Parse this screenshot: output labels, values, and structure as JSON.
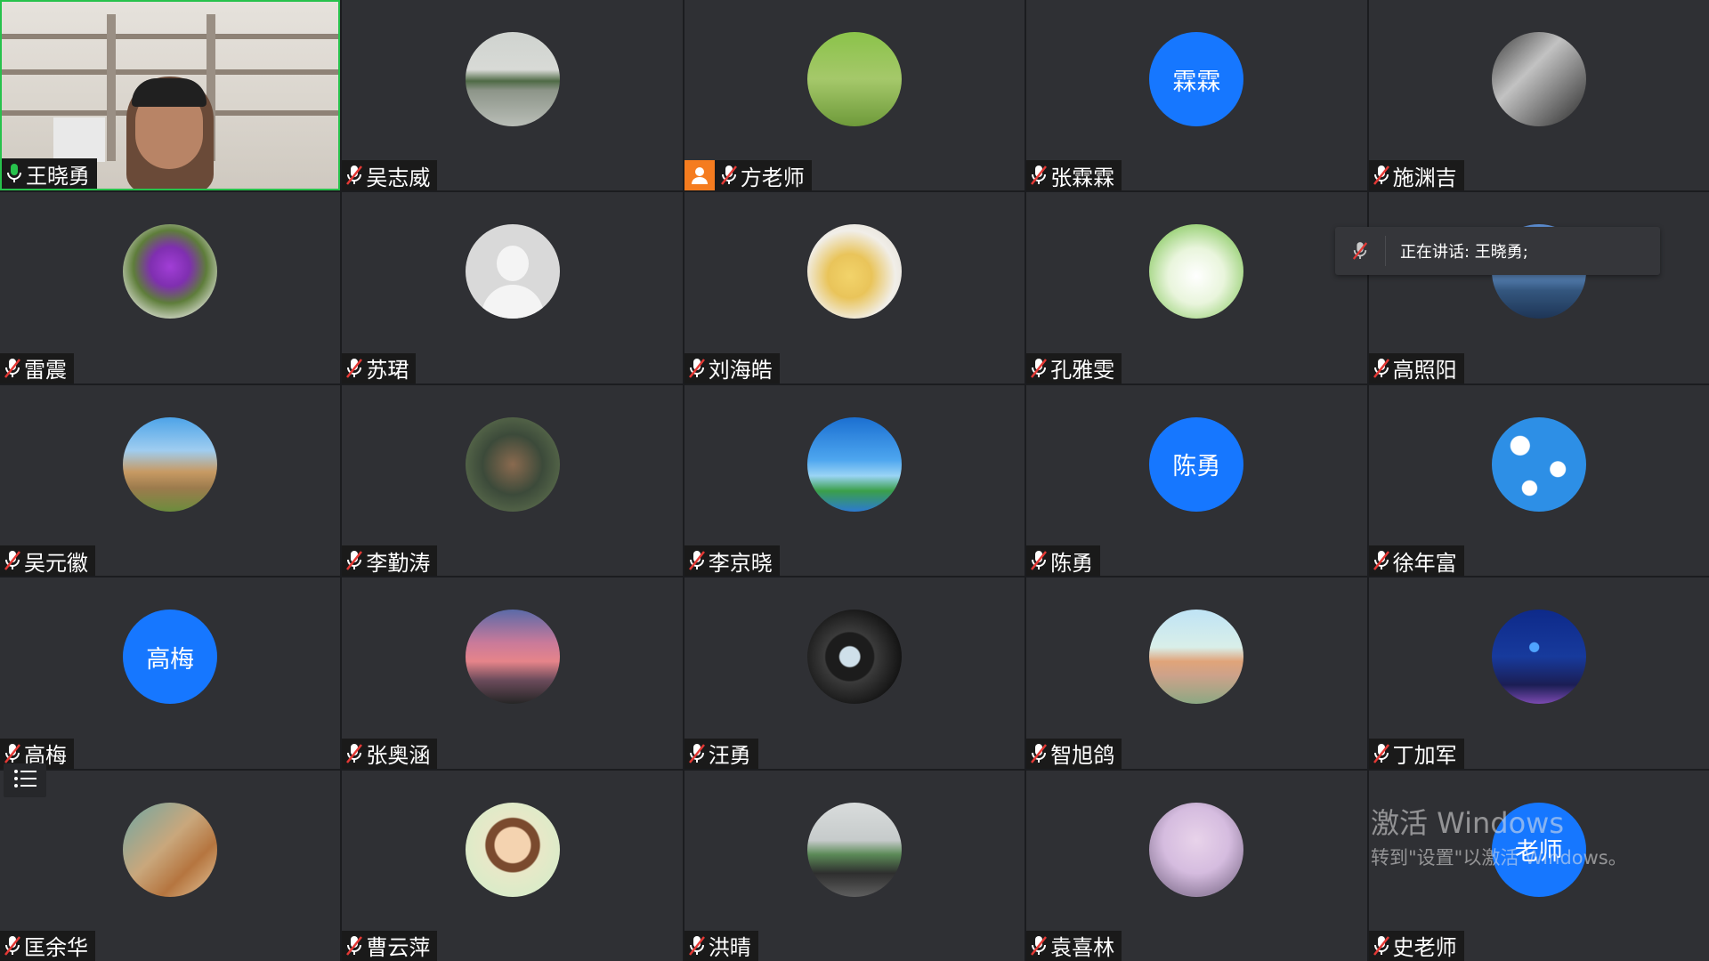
{
  "active_speaker": "王晓勇",
  "speaking_toast": {
    "label": "正在讲话: 王晓勇;"
  },
  "watermark": {
    "title": "激活 Windows",
    "subtitle": "转到\"设置\"以激活 Windows。"
  },
  "colors": {
    "tile_bg": "#2f3034",
    "accent_blue": "#1677ff",
    "active_border": "#27c24c",
    "host_badge": "#f57c1f",
    "mic_muted": "#e53935",
    "mic_on": "#27c24c"
  },
  "participants": [
    {
      "name": "王晓勇",
      "avatar": "camera-video",
      "mic": "on",
      "active": true
    },
    {
      "name": "吴志威",
      "avatar": "photo-lake",
      "mic": "muted"
    },
    {
      "name": "方老师",
      "avatar": "photo-cartoon",
      "mic": "muted",
      "host": true
    },
    {
      "name": "张霖霖",
      "avatar_text": "霖霖",
      "avatar": "initials",
      "mic": "muted"
    },
    {
      "name": "施渊吉",
      "avatar": "photo-portrait",
      "mic": "muted"
    },
    {
      "name": "雷震",
      "avatar": "photo-flower",
      "mic": "muted"
    },
    {
      "name": "苏珺",
      "avatar": "default-person",
      "mic": "muted"
    },
    {
      "name": "刘海皓",
      "avatar": "photo-pet",
      "mic": "muted"
    },
    {
      "name": "孔雅雯",
      "avatar": "photo-cartoon-frog",
      "mic": "muted"
    },
    {
      "name": "高照阳",
      "avatar": "photo-mountain",
      "mic": "muted"
    },
    {
      "name": "吴元徽",
      "avatar": "photo-castle",
      "mic": "muted"
    },
    {
      "name": "李勤涛",
      "avatar": "photo-family",
      "mic": "muted"
    },
    {
      "name": "李京晓",
      "avatar": "photo-sky-island",
      "mic": "muted"
    },
    {
      "name": "陈勇",
      "avatar_text": "陈勇",
      "avatar": "initials",
      "mic": "muted"
    },
    {
      "name": "徐年富",
      "avatar": "photo-clouds",
      "mic": "muted"
    },
    {
      "name": "高梅",
      "avatar_text": "高梅",
      "avatar": "initials",
      "mic": "muted"
    },
    {
      "name": "张奥涵",
      "avatar": "photo-sunset",
      "mic": "muted"
    },
    {
      "name": "汪勇",
      "avatar": "photo-lens",
      "mic": "muted"
    },
    {
      "name": "智旭鸽",
      "avatar": "photo-monument",
      "mic": "muted"
    },
    {
      "name": "丁加军",
      "avatar": "photo-ferris-wheel",
      "mic": "muted"
    },
    {
      "name": "匡余华",
      "avatar": "photo-desert",
      "mic": "muted"
    },
    {
      "name": "曹云萍",
      "avatar": "photo-illustration",
      "mic": "muted"
    },
    {
      "name": "洪晴",
      "avatar": "photo-road",
      "mic": "muted"
    },
    {
      "name": "袁喜林",
      "avatar": "photo-blossom",
      "mic": "muted"
    },
    {
      "name": "史老师",
      "avatar_text": "老师",
      "avatar": "initials",
      "mic": "muted"
    }
  ]
}
